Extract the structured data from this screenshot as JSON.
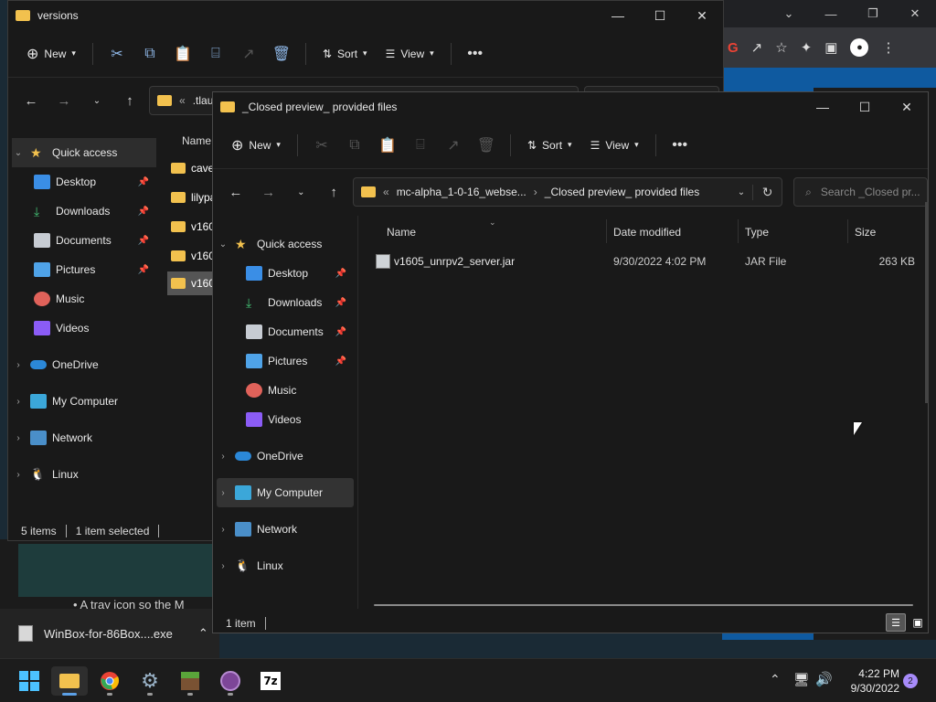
{
  "back_window": {
    "title": "versions",
    "toolbar": {
      "new_label": "New",
      "sort_label": "Sort",
      "view_label": "View"
    },
    "address_prefix": "«",
    "address": ".tlaunch",
    "column_name": "Name",
    "files": [
      "cave",
      "lilypa",
      "v1605",
      "v1605",
      "v160"
    ],
    "nav": [
      {
        "label": "Quick access",
        "icon": "star-icon"
      },
      {
        "label": "Desktop",
        "icon": "desktop-icon"
      },
      {
        "label": "Downloads",
        "icon": "download-icon"
      },
      {
        "label": "Documents",
        "icon": "documents-icon"
      },
      {
        "label": "Pictures",
        "icon": "pictures-icon"
      },
      {
        "label": "Music",
        "icon": "music-icon"
      },
      {
        "label": "Videos",
        "icon": "videos-icon"
      },
      {
        "label": "OneDrive",
        "icon": "cloud-icon"
      },
      {
        "label": "My Computer",
        "icon": "computer-icon"
      },
      {
        "label": "Network",
        "icon": "network-icon"
      },
      {
        "label": "Linux",
        "icon": "linux-icon"
      }
    ],
    "status": {
      "items": "5 items",
      "selected": "1 item selected"
    }
  },
  "front_window": {
    "title": "_Closed preview_ provided files",
    "toolbar": {
      "new_label": "New",
      "sort_label": "Sort",
      "view_label": "View"
    },
    "address_prefix": "«",
    "address_parts": [
      "mc-alpha_1-0-16_webse...",
      "_Closed preview_ provided files"
    ],
    "search_placeholder": "Search _Closed pr...",
    "columns": {
      "name": "Name",
      "date": "Date modified",
      "type": "Type",
      "size": "Size"
    },
    "rows": [
      {
        "name": "v1605_unrpv2_server.jar",
        "date": "9/30/2022 4:02 PM",
        "type": "JAR File",
        "size": "263 KB"
      }
    ],
    "nav": [
      {
        "label": "Quick access",
        "icon": "star-icon"
      },
      {
        "label": "Desktop",
        "icon": "desktop-icon"
      },
      {
        "label": "Downloads",
        "icon": "download-icon"
      },
      {
        "label": "Documents",
        "icon": "documents-icon"
      },
      {
        "label": "Pictures",
        "icon": "pictures-icon"
      },
      {
        "label": "Music",
        "icon": "music-icon"
      },
      {
        "label": "Videos",
        "icon": "videos-icon"
      },
      {
        "label": "OneDrive",
        "icon": "cloud-icon"
      },
      {
        "label": "My Computer",
        "icon": "computer-icon"
      },
      {
        "label": "Network",
        "icon": "network-icon"
      },
      {
        "label": "Linux",
        "icon": "linux-icon"
      }
    ],
    "status": {
      "items": "1 item"
    }
  },
  "browser_bg": {
    "bullet_text": "A tray icon so the M"
  },
  "download_bar": {
    "filename": "WinBox-for-86Box....exe"
  },
  "taskbar": {
    "apps": [
      "start",
      "file-explorer",
      "chrome",
      "settings",
      "minecraft",
      "tor-browser",
      "7zip"
    ],
    "time": "4:22 PM",
    "date": "9/30/2022",
    "notification_count": "2"
  }
}
